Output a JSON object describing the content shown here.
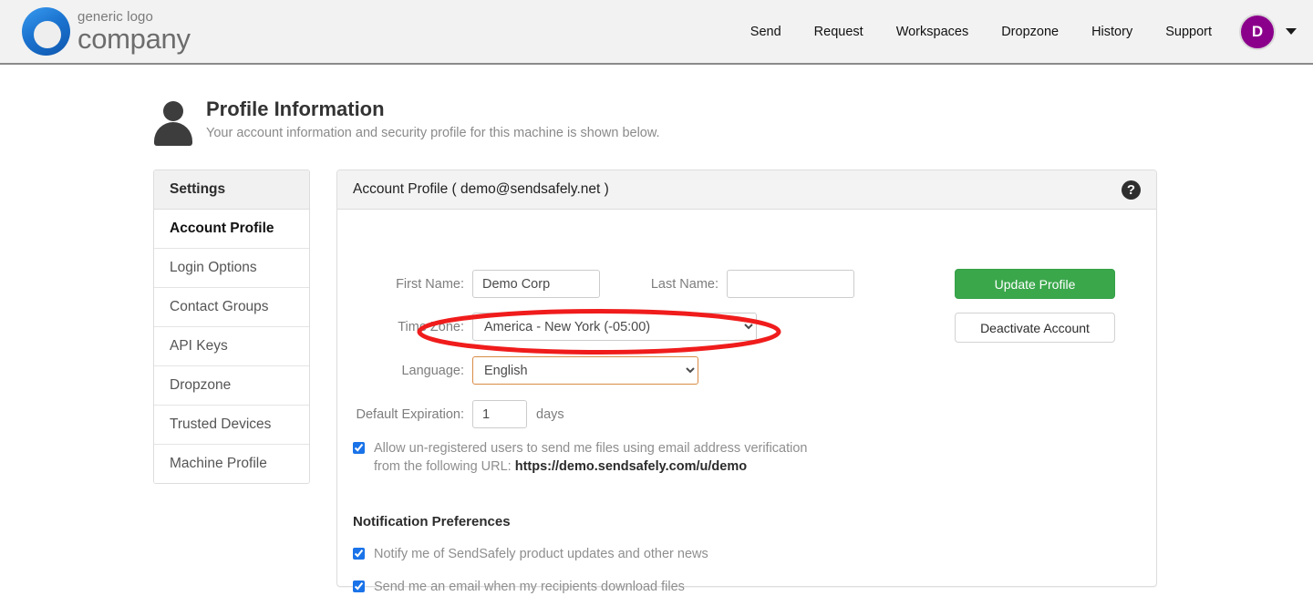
{
  "header": {
    "logo": {
      "tagline": "generic logo",
      "name": "company"
    },
    "nav": [
      {
        "label": "Send"
      },
      {
        "label": "Request"
      },
      {
        "label": "Workspaces"
      },
      {
        "label": "Dropzone"
      },
      {
        "label": "History"
      },
      {
        "label": "Support"
      }
    ],
    "avatar": {
      "initial": "D",
      "color": "#8b008b"
    }
  },
  "page": {
    "title": "Profile Information",
    "subtitle": "Your account information and security profile for this machine is shown below."
  },
  "sidebar": {
    "heading": "Settings",
    "items": [
      {
        "label": "Account Profile",
        "active": true
      },
      {
        "label": "Login Options",
        "active": false
      },
      {
        "label": "Contact Groups",
        "active": false
      },
      {
        "label": "API Keys",
        "active": false
      },
      {
        "label": "Dropzone",
        "active": false
      },
      {
        "label": "Trusted Devices",
        "active": false
      },
      {
        "label": "Machine Profile",
        "active": false
      }
    ]
  },
  "panel": {
    "title": "Account Profile ( demo@sendsafely.net )",
    "help_icon": "question-mark-icon",
    "form": {
      "first_name": {
        "label": "First Name:",
        "value": "Demo Corp",
        "placeholder": ""
      },
      "last_name": {
        "label": "Last Name:",
        "value": "",
        "placeholder": ""
      },
      "time_zone": {
        "label": "Time Zone:",
        "value": "America - New York (-05:00)"
      },
      "language": {
        "label": "Language:",
        "value": "English",
        "focused": true
      },
      "default_expiration": {
        "label": "Default Expiration:",
        "value": "1",
        "suffix": "days"
      }
    },
    "buttons": {
      "update": "Update Profile",
      "deactivate": "Deactivate Account"
    },
    "unregistered": {
      "checked": true,
      "line1": "Allow un-registered users to send me files using email address verification",
      "line2_prefix": "from the following URL: ",
      "url": "https://demo.sendsafely.com/u/demo"
    },
    "notifications": {
      "title": "Notification Preferences",
      "items": [
        {
          "label": "Notify me of SendSafely product updates and other news",
          "checked": true
        },
        {
          "label": "Send me an email when my recipients download files",
          "checked": true
        }
      ]
    }
  },
  "annotation": {
    "shape": "ellipse",
    "color": "#f01c1c",
    "target": "language-select"
  },
  "colors": {
    "header_bg": "#f2f2f2",
    "primary_green": "#3aa74b",
    "avatar_purple": "#8b008b",
    "annotation_red": "#f01c1c",
    "focus_orange": "#d98b45"
  }
}
